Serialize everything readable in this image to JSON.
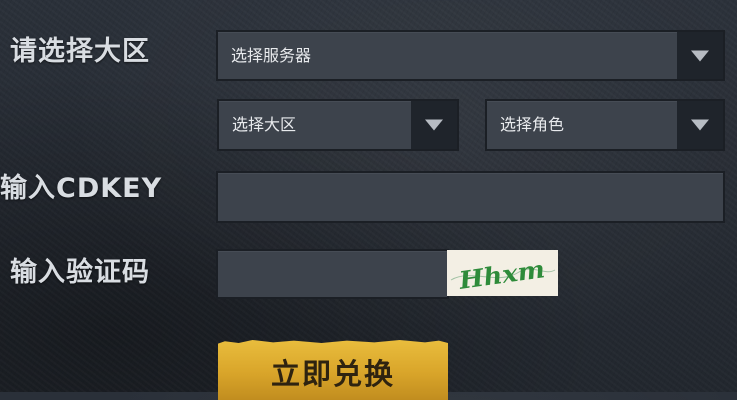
{
  "form": {
    "region_label": "请选择大区",
    "cdkey_label": "输入CDKEY",
    "captcha_label": "输入验证码",
    "server_select": {
      "selected": "选择服务器"
    },
    "region_select": {
      "selected": "选择大区"
    },
    "role_select": {
      "selected": "选择角色"
    },
    "cdkey_input": {
      "value": "",
      "placeholder": ""
    },
    "captcha_input": {
      "value": "",
      "placeholder": ""
    },
    "captcha_image": {
      "text": "Hhxm"
    },
    "redeem_button": {
      "label": "立即兑换"
    }
  },
  "icons": {
    "dropdown": "chevron-down-icon"
  },
  "colors": {
    "background": "#262b33",
    "field": "#3d434c",
    "dropdown_button": "#1f242b",
    "redeem_button": "#d9a52a",
    "captcha_text": "#2e8b3a"
  }
}
